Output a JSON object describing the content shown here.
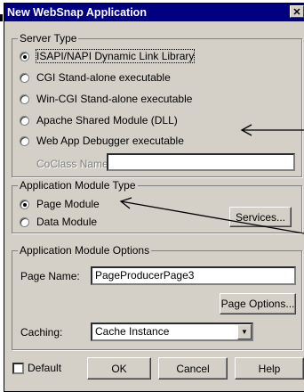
{
  "window": {
    "title": "New WebSnap Application",
    "close_glyph": "✕"
  },
  "server_type": {
    "legend": "Server Type",
    "options": [
      {
        "label": "ISAPI/NAPI Dynamic Link Library",
        "checked": true
      },
      {
        "label": "CGI Stand-alone executable",
        "checked": false
      },
      {
        "label": "Win-CGI Stand-alone executable",
        "checked": false
      },
      {
        "label": "Apache Shared Module (DLL)",
        "checked": false
      },
      {
        "label": "Web App Debugger executable",
        "checked": false
      }
    ],
    "coclass_label": "CoClass Name:",
    "coclass_value": ""
  },
  "module_type": {
    "legend": "Application Module Type",
    "options": [
      {
        "label": "Page Module",
        "checked": true
      },
      {
        "label": "Data Module",
        "checked": false
      }
    ],
    "services_button": "Services..."
  },
  "module_options": {
    "legend": "Application Module Options",
    "page_name_label": "Page Name:",
    "page_name_value": "PageProducerPage3",
    "page_options_button": "Page Options...",
    "caching_label": "Caching:",
    "caching_value": "Cache Instance"
  },
  "footer": {
    "default_label": "Default",
    "default_checked": false,
    "ok_button": "OK",
    "cancel_button": "Cancel",
    "help_button": "Help"
  },
  "icons": {
    "select_arrow": "▼"
  }
}
